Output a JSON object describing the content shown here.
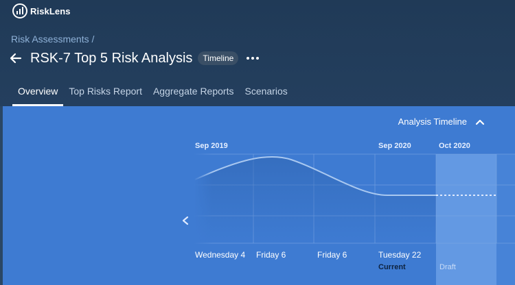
{
  "app": {
    "name": "RiskLens"
  },
  "breadcrumb": {
    "text": "Risk Assessments /"
  },
  "page": {
    "title": "RSK-7 Top 5 Risk Analysis",
    "badge": "Timeline"
  },
  "tabs": [
    {
      "label": "Overview",
      "active": true
    },
    {
      "label": "Top Risks Report",
      "active": false
    },
    {
      "label": "Aggregate Reports",
      "active": false
    },
    {
      "label": "Scenarios",
      "active": false
    }
  ],
  "timeline": {
    "title": "Analysis Timeline",
    "months": [
      "Sep 2019",
      "Sep 2020",
      "Oct 2020"
    ],
    "days": [
      "Wednesday 4",
      "Friday 6",
      "Friday 6",
      "Tuesday 22"
    ],
    "current_label": "Current",
    "draft_label": "Draft"
  },
  "icons": {
    "back": "arrow-left-icon",
    "more": "more-horizontal-icon",
    "collapse": "chevron-up-icon",
    "previous": "chevron-left-icon",
    "logo": "bar-chart-circle-icon"
  },
  "colors": {
    "header_bg": "#213b58",
    "panel_bg": "#3e7bd2",
    "accent": "#ffffff"
  }
}
